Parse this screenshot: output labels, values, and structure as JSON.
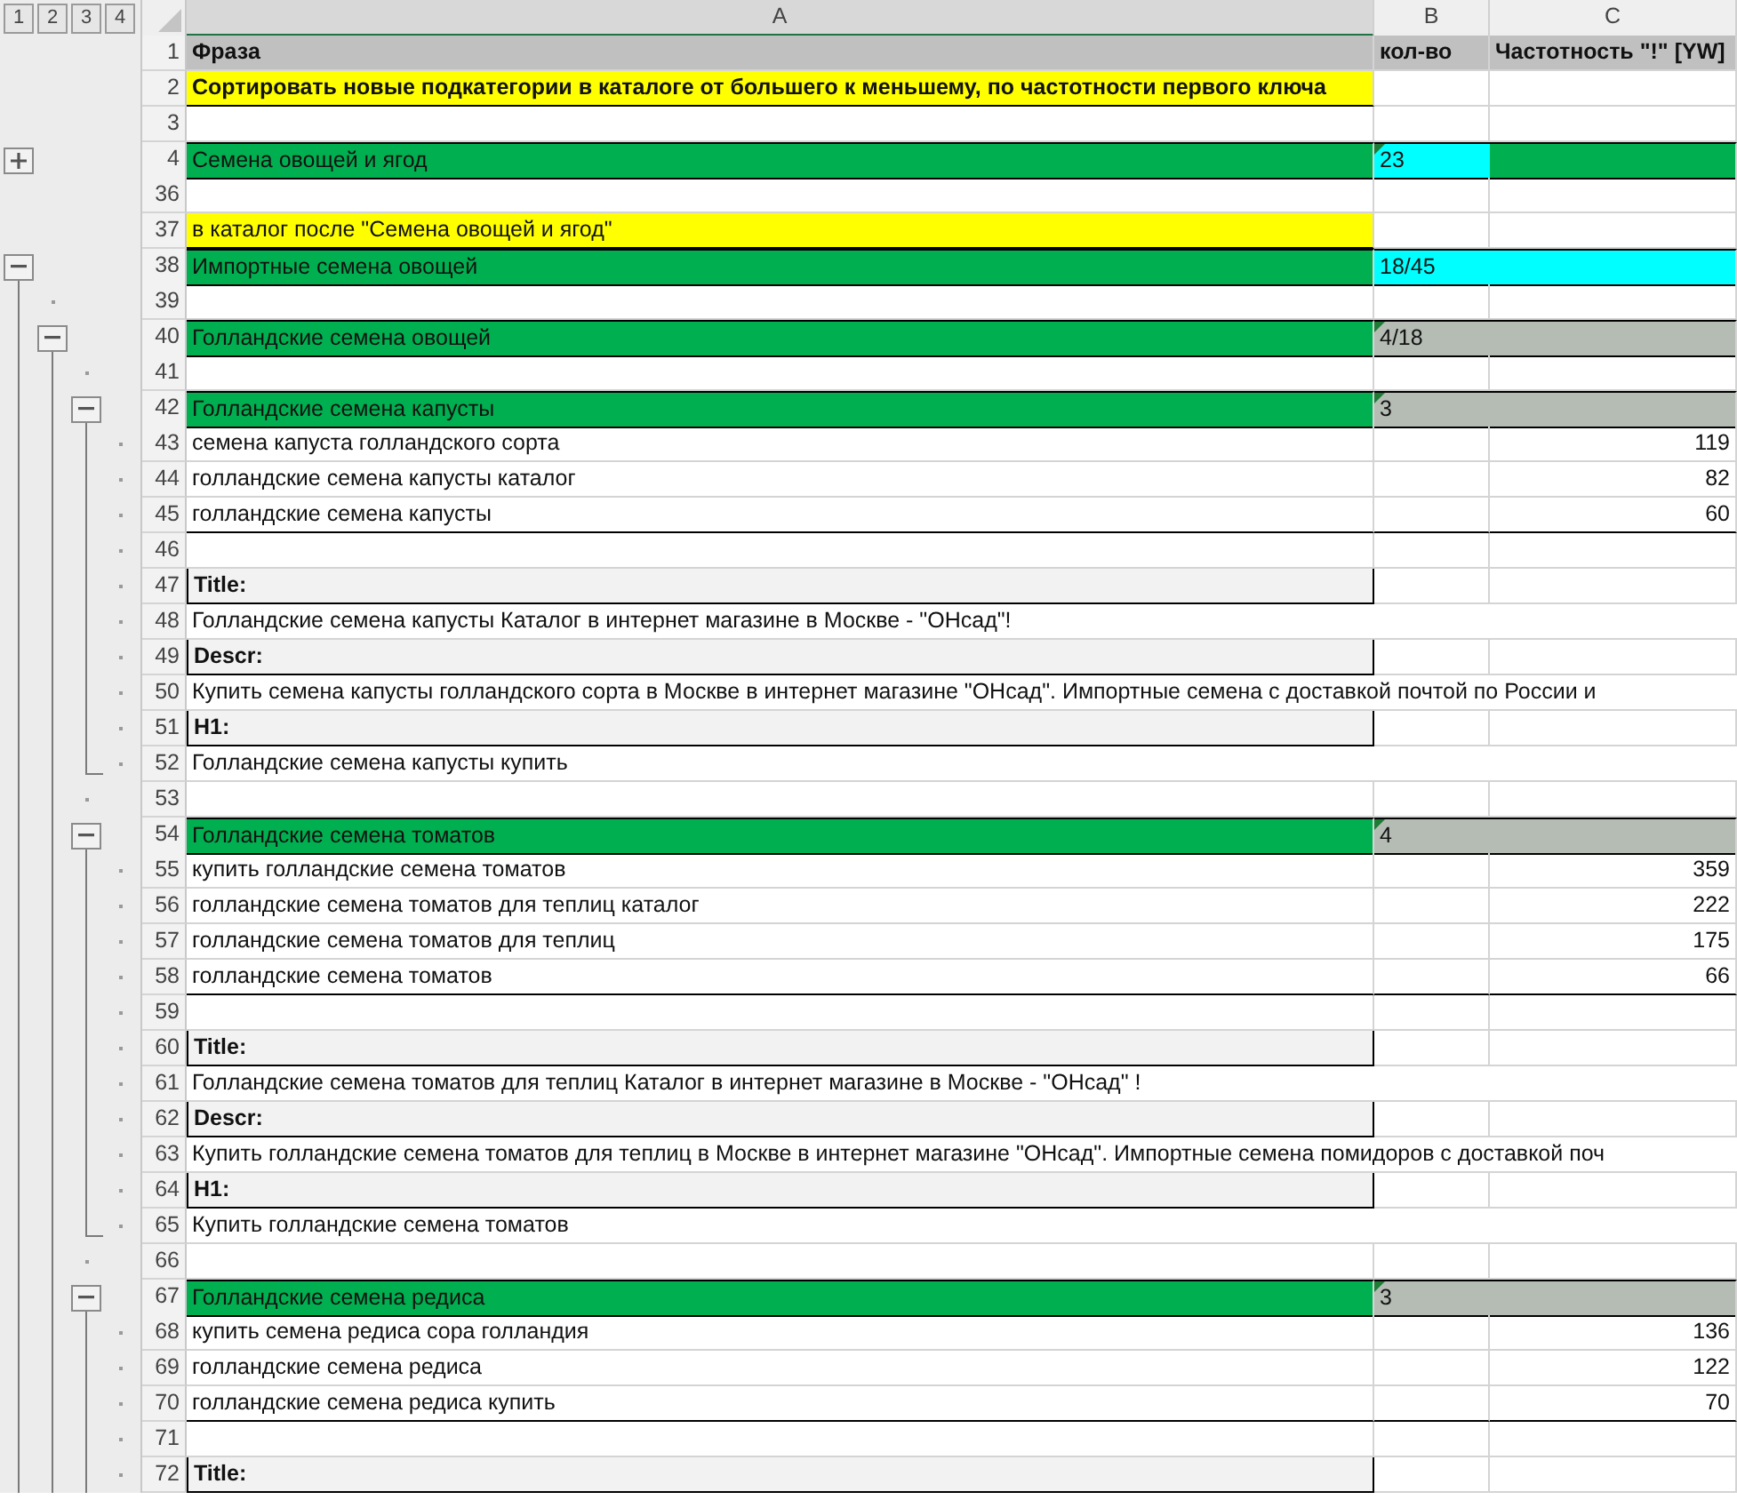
{
  "outline_levels": [
    "1",
    "2",
    "3",
    "4"
  ],
  "columns": [
    {
      "label": "A",
      "selected": true
    },
    {
      "label": "B",
      "selected": false
    },
    {
      "label": "C",
      "selected": false
    }
  ],
  "rows": [
    {
      "num": "1",
      "kind": "header",
      "a": "Фраза",
      "b": "кол-во",
      "c": "Частотность \"!\" [YW]"
    },
    {
      "num": "2",
      "kind": "note",
      "bold": true,
      "a": "Сортировать новые подкатегории в каталоге от большего к меньшему, по частотности первого ключа"
    },
    {
      "num": "3",
      "kind": "blank"
    },
    {
      "num": "4",
      "kind": "group",
      "a": "Семена овощей и ягод",
      "b": {
        "text": "23",
        "color": "#00ffff"
      },
      "c": {
        "color": "#00b050"
      },
      "flag": true,
      "expanded": false
    },
    {
      "num": "36",
      "kind": "blank"
    },
    {
      "num": "37",
      "kind": "note",
      "bold": false,
      "a": "в каталог после \"Семена овощей и ягод\""
    },
    {
      "num": "38",
      "kind": "group",
      "a": "Импортные семена овощей",
      "b": {
        "text": "18/45",
        "color": "#00ffff"
      },
      "c": {
        "color": "#00ffff"
      },
      "flag": false,
      "expanded": true,
      "children": [
        {
          "num": "39",
          "kind": "blank"
        },
        {
          "num": "40",
          "kind": "group",
          "a": "Голландские семена овощей",
          "b": {
            "text": "4/18",
            "color": "#b4bcb4"
          },
          "c": {
            "color": "#b4bcb4"
          },
          "flag": true,
          "expanded": true,
          "children": [
            {
              "num": "41",
              "kind": "blank"
            },
            {
              "num": "42",
              "kind": "group",
              "a": "Голландские семена капусты",
              "b": {
                "text": "3",
                "color": "#b4bcb4"
              },
              "c": {
                "color": "#b4bcb4"
              },
              "flag": true,
              "expanded": true,
              "children": [
                {
                  "num": "43",
                  "kind": "keyword",
                  "a": "семена капуста голландского сорта",
                  "c": "119"
                },
                {
                  "num": "44",
                  "kind": "keyword",
                  "a": "голландские семена капусты каталог",
                  "c": "82"
                },
                {
                  "num": "45",
                  "kind": "keyword",
                  "a": "голландские семена капусты",
                  "c": "60"
                },
                {
                  "num": "46",
                  "kind": "blank"
                },
                {
                  "num": "47",
                  "kind": "label",
                  "a": "Title:"
                },
                {
                  "num": "48",
                  "kind": "text",
                  "a": "Голландские семена капусты Каталог в интернет магазине в Москве - \"ОНсад\"!"
                },
                {
                  "num": "49",
                  "kind": "label",
                  "a": "Descr:"
                },
                {
                  "num": "50",
                  "kind": "text",
                  "a": "Купить семена капусты голландского сорта в Москве в интернет магазине \"ОНсад\". Импортные семена с доставкой почтой по России и"
                },
                {
                  "num": "51",
                  "kind": "label",
                  "a": "H1:"
                },
                {
                  "num": "52",
                  "kind": "text",
                  "a": "Голландские семена капусты купить"
                }
              ]
            },
            {
              "num": "53",
              "kind": "blank"
            },
            {
              "num": "54",
              "kind": "group",
              "a": "Голландские семена томатов",
              "b": {
                "text": "4",
                "color": "#b4bcb4"
              },
              "c": {
                "color": "#b4bcb4"
              },
              "flag": true,
              "expanded": true,
              "children": [
                {
                  "num": "55",
                  "kind": "keyword",
                  "a": "купить голландские семена томатов",
                  "c": "359"
                },
                {
                  "num": "56",
                  "kind": "keyword",
                  "a": "голландские семена томатов для теплиц каталог",
                  "c": "222"
                },
                {
                  "num": "57",
                  "kind": "keyword",
                  "a": "голландские семена томатов для теплиц",
                  "c": "175"
                },
                {
                  "num": "58",
                  "kind": "keyword",
                  "a": "голландские семена томатов",
                  "c": "66"
                },
                {
                  "num": "59",
                  "kind": "blank"
                },
                {
                  "num": "60",
                  "kind": "label",
                  "a": "Title:"
                },
                {
                  "num": "61",
                  "kind": "text",
                  "a": "Голландские семена томатов для теплиц Каталог в интернет магазине в Москве - \"ОНсад\" !"
                },
                {
                  "num": "62",
                  "kind": "label",
                  "a": "Descr:"
                },
                {
                  "num": "63",
                  "kind": "text",
                  "a": "Купить голландские семена томатов для теплиц в Москве в интернет магазине \"ОНсад\". Импортные семена помидоров с доставкой поч"
                },
                {
                  "num": "64",
                  "kind": "label",
                  "a": "H1:"
                },
                {
                  "num": "65",
                  "kind": "text",
                  "a": "Купить голландские семена томатов"
                }
              ]
            },
            {
              "num": "66",
              "kind": "blank"
            },
            {
              "num": "67",
              "kind": "group",
              "a": "Голландские семена редиса",
              "b": {
                "text": "3",
                "color": "#b4bcb4"
              },
              "c": {
                "color": "#b4bcb4"
              },
              "flag": true,
              "expanded": true,
              "children": [
                {
                  "num": "68",
                  "kind": "keyword",
                  "a": "купить семена редиса сора голландия",
                  "c": "136"
                },
                {
                  "num": "69",
                  "kind": "keyword",
                  "a": "голландские семена редиса",
                  "c": "122"
                },
                {
                  "num": "70",
                  "kind": "keyword",
                  "a": "голландские семена редиса купить",
                  "c": "70"
                },
                {
                  "num": "71",
                  "kind": "blank"
                },
                {
                  "num": "72",
                  "kind": "label",
                  "a": "Title:"
                }
              ]
            }
          ]
        }
      ]
    }
  ]
}
